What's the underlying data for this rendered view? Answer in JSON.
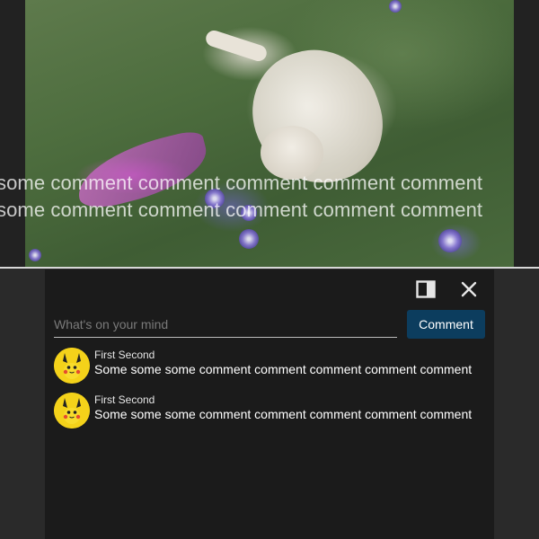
{
  "video": {
    "overlay_lines": [
      "some comment comment comment comment comment",
      "some comment comment comment comment comment"
    ]
  },
  "panel": {
    "icons": [
      "sidebar-panel-icon",
      "close-icon"
    ],
    "input": {
      "placeholder": "What's on your mind",
      "value": ""
    },
    "comment_button_label": "Comment",
    "comments": [
      {
        "author": "First Second",
        "text": "Some some some comment comment comment comment comment",
        "avatar": "pikachu-avatar"
      },
      {
        "author": "First Second",
        "text": "Some some some comment comment comment comment comment",
        "avatar": "pikachu-avatar"
      }
    ]
  },
  "colors": {
    "panel_background": "#1b1b1b",
    "page_background": "#2a2a2a",
    "button_background": "#0c3d5e",
    "avatar_yellow": "#f4d21a"
  }
}
